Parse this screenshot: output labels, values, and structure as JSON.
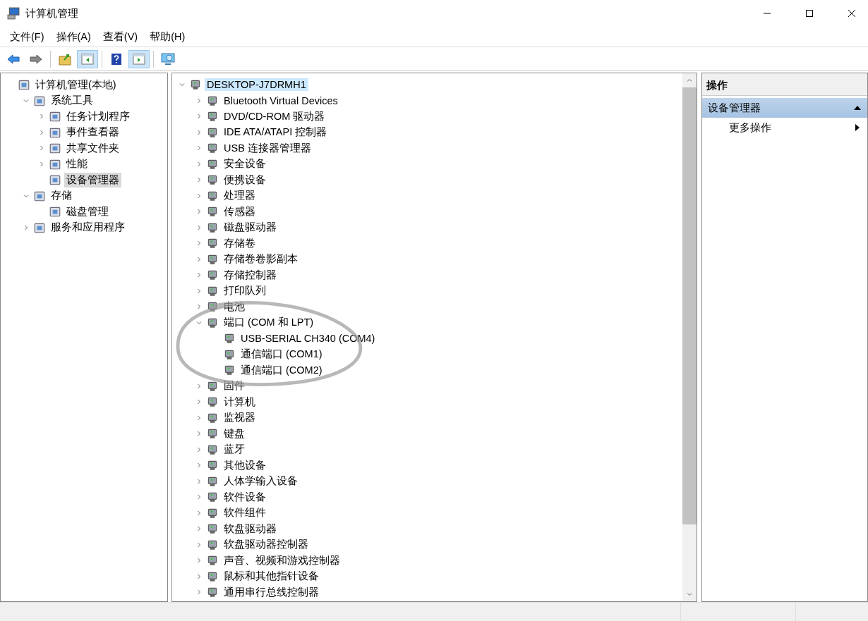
{
  "window": {
    "title": "计算机管理"
  },
  "menu": [
    "文件(F)",
    "操作(A)",
    "查看(V)",
    "帮助(H)"
  ],
  "toolbar": [
    {
      "kind": "back",
      "pressed": false
    },
    {
      "kind": "forward",
      "pressed": false
    },
    {
      "kind": "up",
      "pressed": false
    },
    {
      "kind": "pane",
      "pressed": true
    },
    {
      "kind": "help",
      "pressed": false
    },
    {
      "kind": "actionpane",
      "pressed": true
    },
    {
      "kind": "monitor",
      "pressed": false
    }
  ],
  "console_tree": [
    {
      "label": "计算机管理(本地)",
      "selected": false,
      "children": [
        {
          "label": "系统工具",
          "expanded": true,
          "selected": false,
          "children": [
            {
              "label": "任务计划程序",
              "expanded": false,
              "selected": false
            },
            {
              "label": "事件查看器",
              "expanded": false,
              "selected": false
            },
            {
              "label": "共享文件夹",
              "expanded": false,
              "selected": false
            },
            {
              "label": "性能",
              "expanded": false,
              "selected": false
            },
            {
              "label": "设备管理器",
              "selected": true
            }
          ]
        },
        {
          "label": "存储",
          "expanded": true,
          "selected": false,
          "children": [
            {
              "label": "磁盘管理",
              "selected": false
            }
          ]
        },
        {
          "label": "服务和应用程序",
          "expanded": false,
          "selected": false
        }
      ]
    }
  ],
  "device_tree": [
    {
      "label": "DESKTOP-J7DRMH1",
      "expanded": true,
      "selected": true,
      "children": [
        {
          "label": "Bluetooth Virtual Devices",
          "expanded": false,
          "selected": false
        },
        {
          "label": "DVD/CD-ROM 驱动器",
          "expanded": false,
          "selected": false
        },
        {
          "label": "IDE ATA/ATAPI 控制器",
          "expanded": false,
          "selected": false
        },
        {
          "label": "USB 连接器管理器",
          "expanded": false,
          "selected": false
        },
        {
          "label": "安全设备",
          "expanded": false,
          "selected": false
        },
        {
          "label": "便携设备",
          "expanded": false,
          "selected": false
        },
        {
          "label": "处理器",
          "expanded": false,
          "selected": false
        },
        {
          "label": "传感器",
          "expanded": false,
          "selected": false
        },
        {
          "label": "磁盘驱动器",
          "expanded": false,
          "selected": false
        },
        {
          "label": "存储卷",
          "expanded": false,
          "selected": false
        },
        {
          "label": "存储卷卷影副本",
          "expanded": false,
          "selected": false
        },
        {
          "label": "存储控制器",
          "expanded": false,
          "selected": false
        },
        {
          "label": "打印队列",
          "expanded": false,
          "selected": false
        },
        {
          "label": "电池",
          "expanded": false,
          "selected": false
        },
        {
          "label": "端口 (COM 和 LPT)",
          "expanded": true,
          "selected": false,
          "children": [
            {
              "label": "USB-SERIAL CH340 (COM4)",
              "selected": false
            },
            {
              "label": "通信端口 (COM1)",
              "selected": false
            },
            {
              "label": "通信端口 (COM2)",
              "selected": false
            }
          ]
        },
        {
          "label": "固件",
          "expanded": false,
          "selected": false
        },
        {
          "label": "计算机",
          "expanded": false,
          "selected": false
        },
        {
          "label": "监视器",
          "expanded": false,
          "selected": false
        },
        {
          "label": "键盘",
          "expanded": false,
          "selected": false
        },
        {
          "label": "蓝牙",
          "expanded": false,
          "selected": false
        },
        {
          "label": "其他设备",
          "expanded": false,
          "selected": false
        },
        {
          "label": "人体学输入设备",
          "expanded": false,
          "selected": false
        },
        {
          "label": "软件设备",
          "expanded": false,
          "selected": false
        },
        {
          "label": "软件组件",
          "expanded": false,
          "selected": false
        },
        {
          "label": "软盘驱动器",
          "expanded": false,
          "selected": false
        },
        {
          "label": "软盘驱动器控制器",
          "expanded": false,
          "selected": false
        },
        {
          "label": "声音、视频和游戏控制器",
          "expanded": false,
          "selected": false
        },
        {
          "label": "鼠标和其他指针设备",
          "expanded": false,
          "selected": false
        },
        {
          "label": "通用串行总线控制器",
          "expanded": false,
          "selected": false
        }
      ]
    }
  ],
  "actions": {
    "header": "操作",
    "section": {
      "label": "设备管理器",
      "expanded": true
    },
    "items": [
      {
        "label": "更多操作"
      }
    ]
  }
}
